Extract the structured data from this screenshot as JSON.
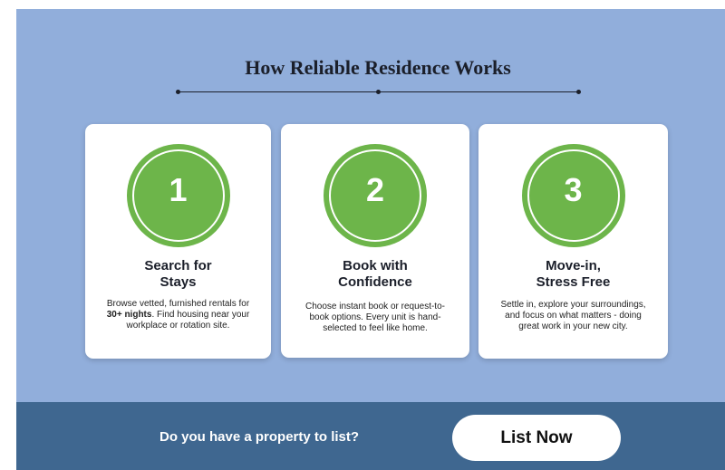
{
  "section": {
    "heading": "How Reliable Residence Works"
  },
  "steps": [
    {
      "number": "1",
      "title_line1": "Search for",
      "title_line2": "Stays",
      "desc_part1": "Browse vetted, furnished rentals for ",
      "desc_bold": "30+ nights",
      "desc_part2": ". Find housing near your workplace or rotation site."
    },
    {
      "number": "2",
      "title_line1": "Book with",
      "title_line2": "Confidence",
      "desc": "Choose instant book or request-to-book options. Every unit is hand-selected to feel like home."
    },
    {
      "number": "3",
      "title_line1": "Move-in,",
      "title_line2": "Stress Free",
      "desc": "Settle in, explore your surroundings, and focus on what matters - doing great work in your new city."
    }
  ],
  "footer": {
    "question": "Do you have a property to list?",
    "button_label": "List Now"
  },
  "colors": {
    "section_bg": "#91aedb",
    "footer_bg": "#3f6790",
    "step_circle": "#6db54a"
  }
}
